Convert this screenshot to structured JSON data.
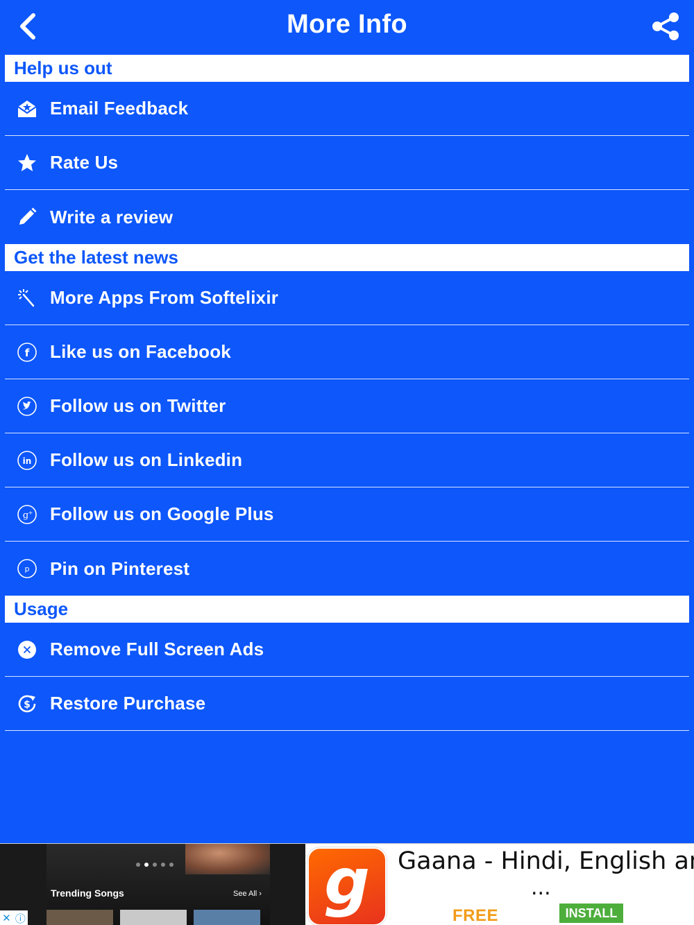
{
  "header": {
    "title": "More Info",
    "back_icon": "chevron-left-icon",
    "share_icon": "share-icon"
  },
  "sections": [
    {
      "title": "Help us out",
      "items": [
        {
          "label": "Email Feedback",
          "icon": "email-feedback-icon"
        },
        {
          "label": "Rate Us",
          "icon": "star-icon"
        },
        {
          "label": "Write a review",
          "icon": "pencil-icon"
        }
      ]
    },
    {
      "title": "Get the latest news",
      "items": [
        {
          "label": "More Apps From Softelixir",
          "icon": "magic-wand-icon"
        },
        {
          "label": "Like us on Facebook",
          "icon": "facebook-icon"
        },
        {
          "label": "Follow us on Twitter",
          "icon": "twitter-icon"
        },
        {
          "label": "Follow us on Linkedin",
          "icon": "linkedin-icon"
        },
        {
          "label": "Follow us on Google Plus",
          "icon": "google-plus-icon"
        },
        {
          "label": "Pin on Pinterest",
          "icon": "pinterest-icon"
        }
      ]
    },
    {
      "title": "Usage",
      "items": [
        {
          "label": "Remove Full Screen Ads",
          "icon": "remove-ads-icon"
        },
        {
          "label": "Restore Purchase",
          "icon": "restore-purchase-icon"
        }
      ]
    }
  ],
  "ad": {
    "trending_label": "Trending Songs",
    "see_all_label": "See All",
    "app_title": "Gaana - Hindi, English and",
    "ellipsis": "...",
    "price_label": "FREE",
    "install_label": "INSTALL",
    "logo_letter": "g",
    "colors": {
      "free": "#f29c1b",
      "install": "#4dae3c",
      "logo": "#ff6a00"
    }
  },
  "colors": {
    "background": "#0d57fb",
    "section_header_bg": "#ffffff",
    "section_header_text": "#0d57fb",
    "text": "#ffffff"
  }
}
